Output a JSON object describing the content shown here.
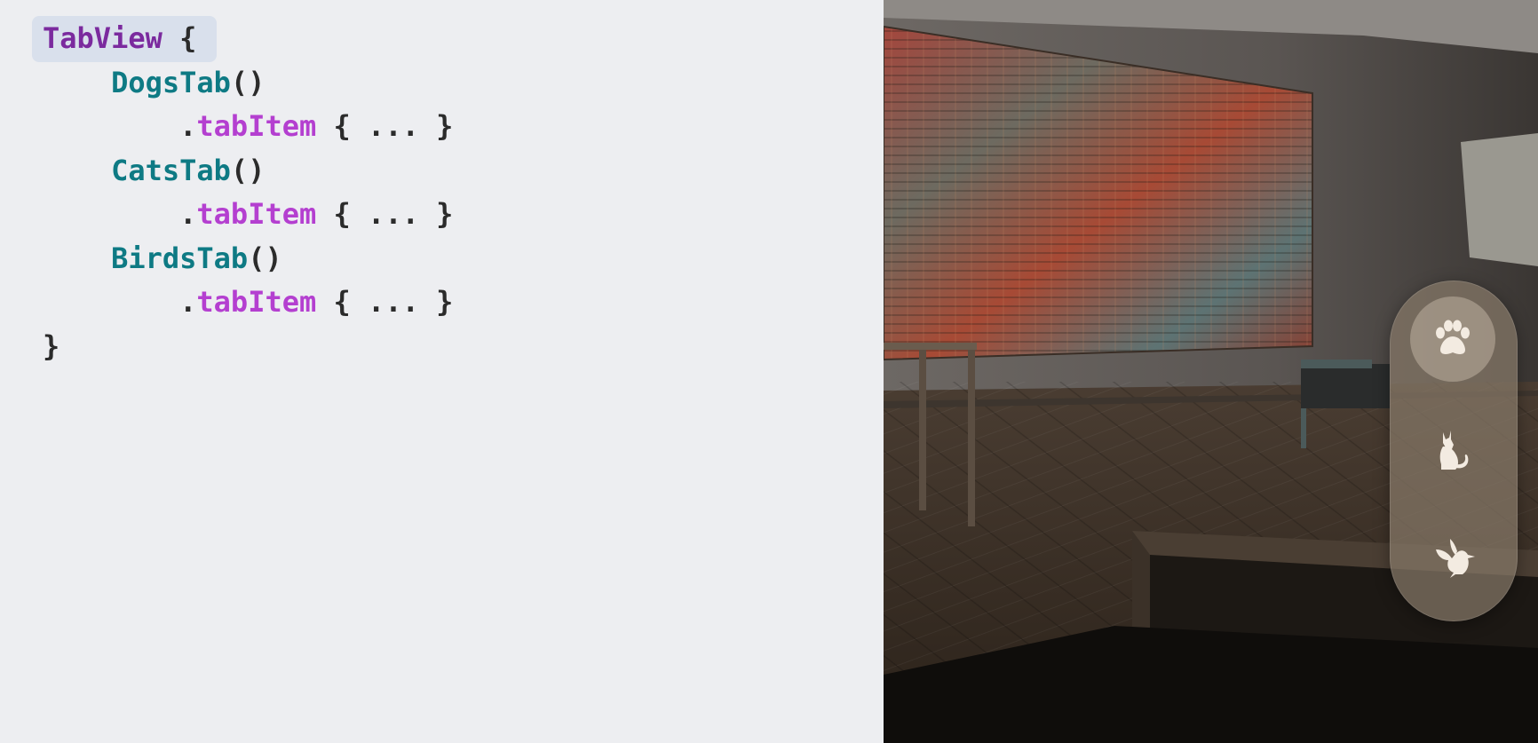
{
  "code": {
    "lines": [
      {
        "tokens": [
          {
            "t": "TabView",
            "c": "kw"
          },
          {
            "t": " {",
            "c": "pl"
          }
        ]
      },
      {
        "tokens": [
          {
            "t": "    ",
            "c": "pl"
          },
          {
            "t": "DogsTab",
            "c": "ty"
          },
          {
            "t": "()",
            "c": "pl"
          }
        ]
      },
      {
        "tokens": [
          {
            "t": "        .",
            "c": "pl"
          },
          {
            "t": "tabItem",
            "c": "md"
          },
          {
            "t": " { ... }",
            "c": "pl"
          }
        ]
      },
      {
        "tokens": [
          {
            "t": "    ",
            "c": "pl"
          },
          {
            "t": "CatsTab",
            "c": "ty"
          },
          {
            "t": "()",
            "c": "pl"
          }
        ]
      },
      {
        "tokens": [
          {
            "t": "        .",
            "c": "pl"
          },
          {
            "t": "tabItem",
            "c": "md"
          },
          {
            "t": " { ... }",
            "c": "pl"
          }
        ]
      },
      {
        "tokens": [
          {
            "t": "    ",
            "c": "pl"
          },
          {
            "t": "BirdsTab",
            "c": "ty"
          },
          {
            "t": "()",
            "c": "pl"
          }
        ]
      },
      {
        "tokens": [
          {
            "t": "        .",
            "c": "pl"
          },
          {
            "t": "tabItem",
            "c": "md"
          },
          {
            "t": " { ... }",
            "c": "pl"
          }
        ]
      },
      {
        "tokens": [
          {
            "t": "}",
            "c": "pl"
          }
        ]
      }
    ],
    "highlighted_token": "TabView"
  },
  "tabbar": {
    "items": [
      {
        "icon": "paw-icon",
        "selected": true
      },
      {
        "icon": "cat-icon",
        "selected": false
      },
      {
        "icon": "bird-icon",
        "selected": false
      }
    ]
  },
  "colors": {
    "keyword": "#7b2a9e",
    "type": "#0e7a84",
    "method": "#b43fd0",
    "plain": "#2b2b2b",
    "highlight_bg": "#d9e0ec",
    "code_bg": "#edeef1",
    "icon_fill": "#f3ebe1"
  }
}
